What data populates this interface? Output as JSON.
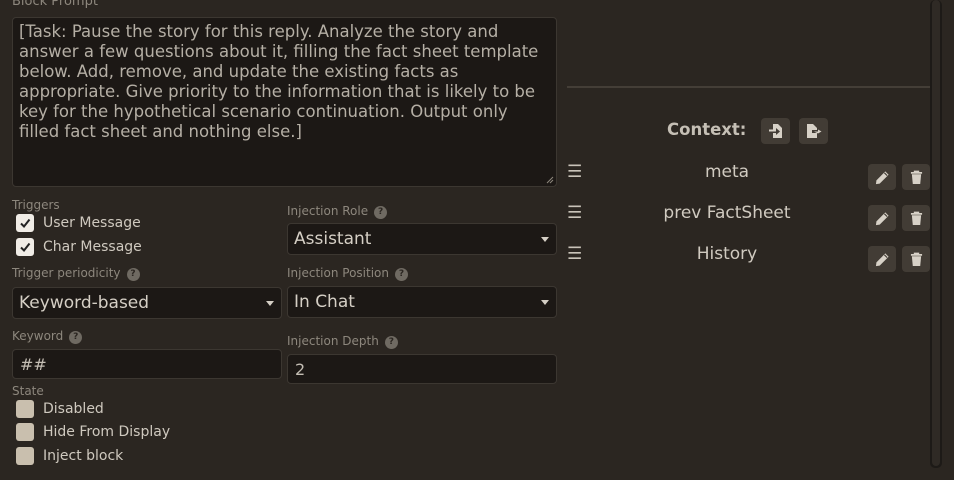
{
  "block_prompt": {
    "label": "Block Prompt",
    "text": "[Task: Pause the story for this reply. Analyze the story and answer a few questions about it, filling the fact sheet template below. Add, remove, and update the existing facts as appropriate. Give priority to the information that is likely to be key for the hypothetical scenario continuation. Output only filled fact sheet and nothing else.]"
  },
  "triggers": {
    "label": "Triggers",
    "items": [
      {
        "label": "User Message",
        "checked": true
      },
      {
        "label": "Char Message",
        "checked": true
      }
    ]
  },
  "injection_role": {
    "label": "Injection Role",
    "value": "Assistant"
  },
  "trigger_periodicity": {
    "label": "Trigger periodicity",
    "value": "Keyword-based"
  },
  "injection_position": {
    "label": "Injection Position",
    "value": "In Chat"
  },
  "keyword": {
    "label": "Keyword",
    "value": "##"
  },
  "injection_depth": {
    "label": "Injection Depth",
    "value": "2"
  },
  "state": {
    "label": "State",
    "items": [
      {
        "label": "Disabled",
        "checked": false
      },
      {
        "label": "Hide From Display",
        "checked": false
      },
      {
        "label": "Inject block",
        "checked": false
      }
    ]
  },
  "context": {
    "title": "Context:",
    "items": [
      {
        "name": "meta"
      },
      {
        "name": "prev FactSheet"
      },
      {
        "name": "History"
      }
    ]
  },
  "icons": {
    "help": "question-circle-icon",
    "import": "file-import-icon",
    "export": "file-export-icon",
    "drag": "drag-handle-icon",
    "edit": "pencil-icon",
    "delete": "trash-icon"
  },
  "colors": {
    "background": "#2b2621",
    "field_background": "#1c1815",
    "button_background": "#423c35",
    "checkbox_checked": "#f0ece6",
    "checkbox_unchecked": "#c9bfae"
  }
}
